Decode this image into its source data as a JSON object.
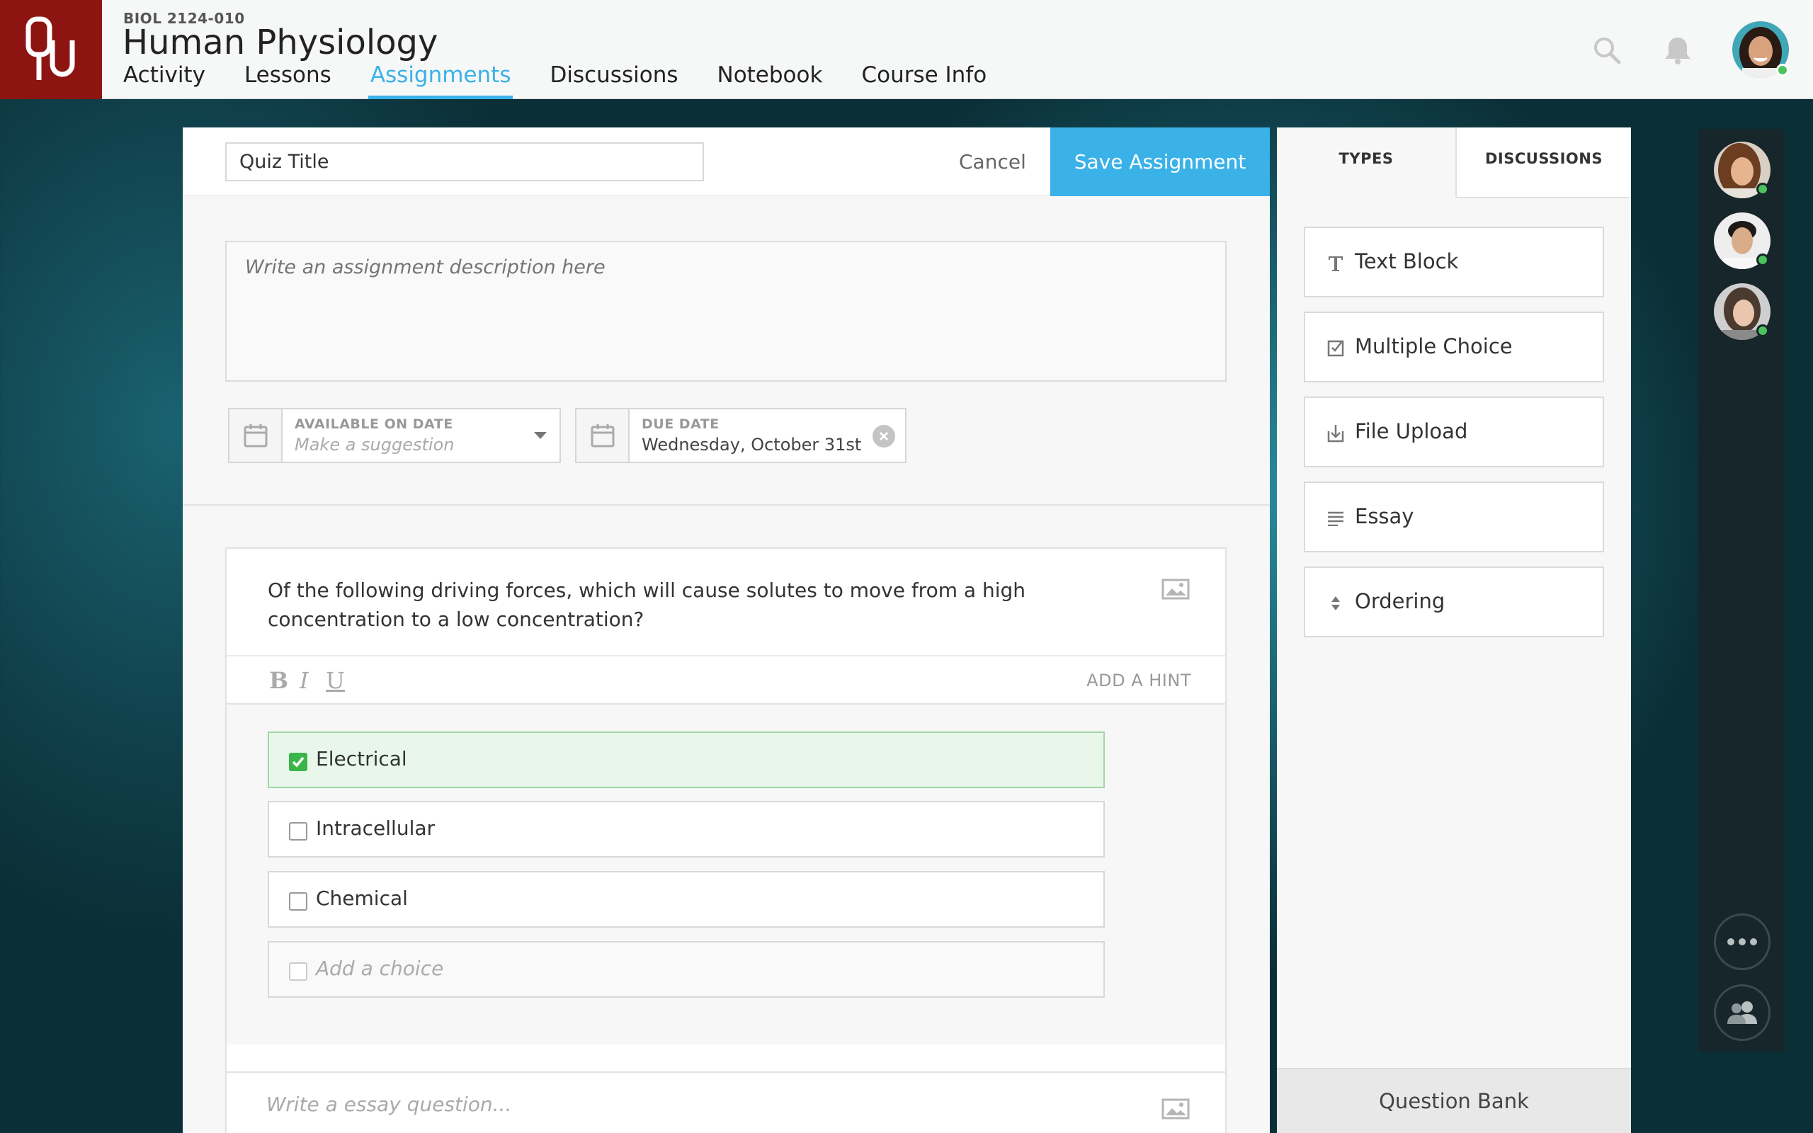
{
  "header": {
    "course_code": "BIOL 2124-010",
    "course_title": "Human Physiology",
    "nav": [
      {
        "label": "Activity"
      },
      {
        "label": "Lessons"
      },
      {
        "label": "Assignments",
        "active": true
      },
      {
        "label": "Discussions"
      },
      {
        "label": "Notebook"
      },
      {
        "label": "Course Info"
      }
    ],
    "icons": [
      "search-icon",
      "bell-icon"
    ]
  },
  "editor": {
    "quiz_title_value": "Quiz Title",
    "cancel_label": "Cancel",
    "save_label": "Save Assignment",
    "description_placeholder": "Write an assignment description here",
    "available_date": {
      "label": "AVAILABLE ON DATE",
      "placeholder": "Make a suggestion"
    },
    "due_date": {
      "label": "DUE DATE",
      "value": "Wednesday, October 31st"
    },
    "question": {
      "text": "Of the following driving forces, which will cause solutes to move from a high concentration to a low concentration?",
      "format": {
        "bold": "B",
        "italic": "I",
        "underline": "U"
      },
      "hint_label": "ADD A HINT",
      "choices": [
        {
          "label": "Electrical",
          "checked": true
        },
        {
          "label": "Intracellular",
          "checked": false
        },
        {
          "label": "Chemical",
          "checked": false
        }
      ],
      "add_choice_placeholder": "Add a choice"
    },
    "essay_placeholder": "Write a essay question..."
  },
  "types_panel": {
    "tabs": [
      {
        "label": "TYPES",
        "active": true
      },
      {
        "label": "DISCUSSIONS"
      }
    ],
    "items": [
      {
        "label": "Text Block",
        "icon": "text-icon"
      },
      {
        "label": "Multiple Choice",
        "icon": "checkbox-icon"
      },
      {
        "label": "File Upload",
        "icon": "upload-icon"
      },
      {
        "label": "Essay",
        "icon": "lines-icon"
      },
      {
        "label": "Ordering",
        "icon": "sort-icon"
      }
    ],
    "question_bank_label": "Question Bank"
  },
  "colors": {
    "accent": "#3ab2e8",
    "brand": "#8c1512",
    "correct_bg": "#e9f6ea",
    "online": "#4cc25c"
  }
}
